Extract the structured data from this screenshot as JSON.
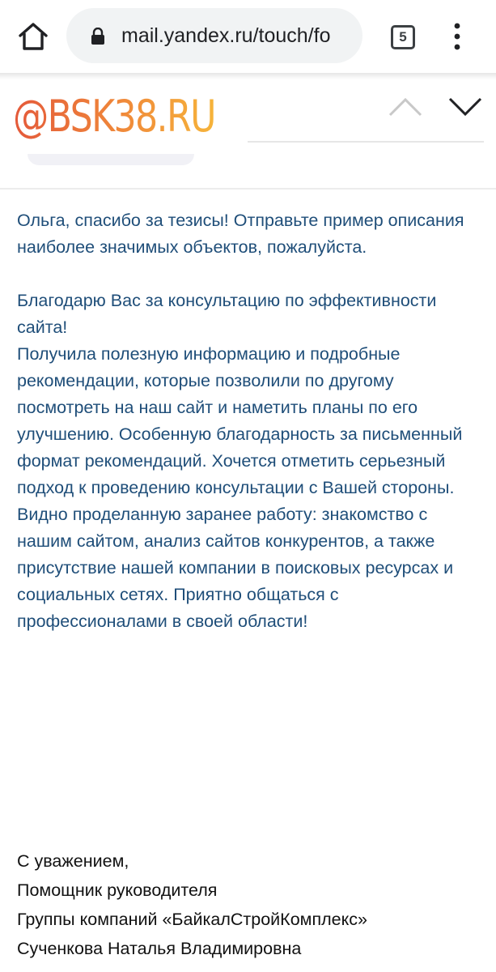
{
  "browser": {
    "url": "mail.yandex.ru/touch/fo",
    "tab_count": "5",
    "icons": [
      "home-icon",
      "lock-icon",
      "tabs-icon",
      "more-vert-icon"
    ]
  },
  "mail_header": {
    "watermark": "@BSK38.RU",
    "icons": [
      "chevron-up-icon",
      "chevron-down-icon"
    ]
  },
  "message": {
    "paragraph1": "Ольга, спасибо за тезисы! Отправьте пример описания наиболее значимых объектов, пожалуйста.",
    "paragraph2": "Благодарю Вас за консультацию по эффективности сайта!",
    "paragraph3": "Получила полезную информацию и подробные рекомендации, которые позволили по другому посмотреть на наш сайт и наметить планы по его улучшению. Особенную благодарность за письменный формат рекомендаций. Хочется отметить серьезный подход к проведению консультации с Вашей стороны. Видно проделанную заранее работу: знакомство с нашим сайтом, анализ сайтов конкурентов, а также присутствие нашей компании в поисковых ресурсах и социальных сетях. Приятно общаться с профессионалами в своей области!"
  },
  "signature": {
    "line1": "С уважением,",
    "line2": "Помощник руководителя",
    "line3": "Группы компаний «БайкалСтройКомплекс»",
    "line4": "Сученкова Наталья Владимировна"
  },
  "colors": {
    "message_text": "#1f4e79",
    "signature_text": "#111111",
    "watermark_gradient_start": "#e4593a",
    "watermark_gradient_end": "#f6b43a",
    "url_bar_bg": "#f1f3f4"
  }
}
